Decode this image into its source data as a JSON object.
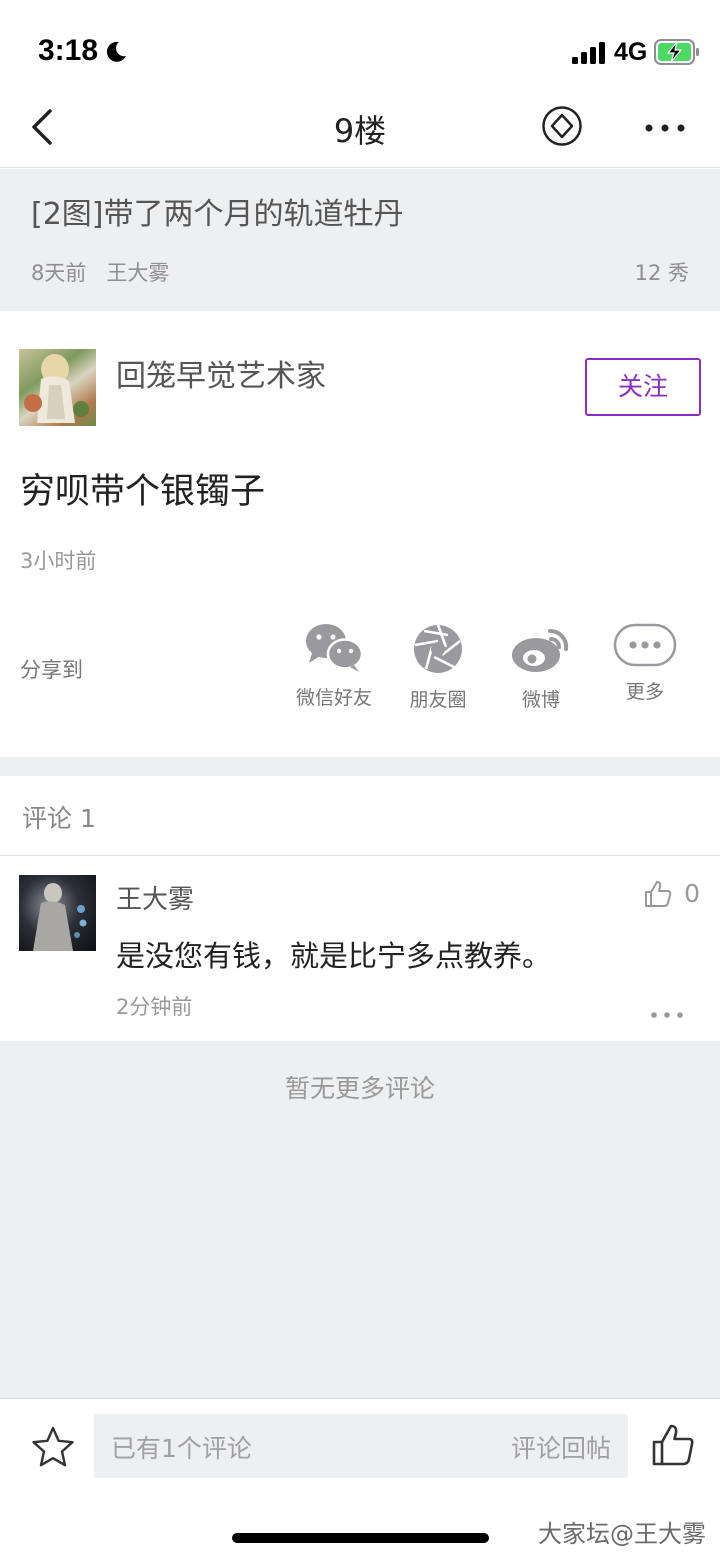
{
  "status_bar": {
    "time": "3:18",
    "network": "4G"
  },
  "nav": {
    "title": "9楼"
  },
  "post": {
    "title": "[2图]带了两个月的轨道牡丹",
    "age": "8天前",
    "author": "王大雾",
    "xiu": "12 秀"
  },
  "floor": {
    "username": "回笼早觉艺术家",
    "follow_label": "关注",
    "content": "穷呗带个银镯子",
    "time": "3小时前",
    "share_label": "分享到",
    "share_targets": [
      {
        "label": "微信好友",
        "icon": "wechat-icon"
      },
      {
        "label": "朋友圈",
        "icon": "moments-icon"
      },
      {
        "label": "微博",
        "icon": "weibo-icon"
      },
      {
        "label": "更多",
        "icon": "more-share-icon"
      }
    ]
  },
  "comments": {
    "header": "评论 1",
    "items": [
      {
        "username": "王大雾",
        "likes": "0",
        "text": "是没您有钱，就是比宁多点教养。",
        "time": "2分钟前"
      }
    ],
    "no_more": "暂无更多评论"
  },
  "bottom_bar": {
    "placeholder": "已有1个评论",
    "submit_label": "评论回帖"
  },
  "watermark": "大家坛@王大雾",
  "colors": {
    "accent": "#8a2fc2",
    "background_gray": "#eeeff1",
    "battery_green": "#4cd964"
  }
}
